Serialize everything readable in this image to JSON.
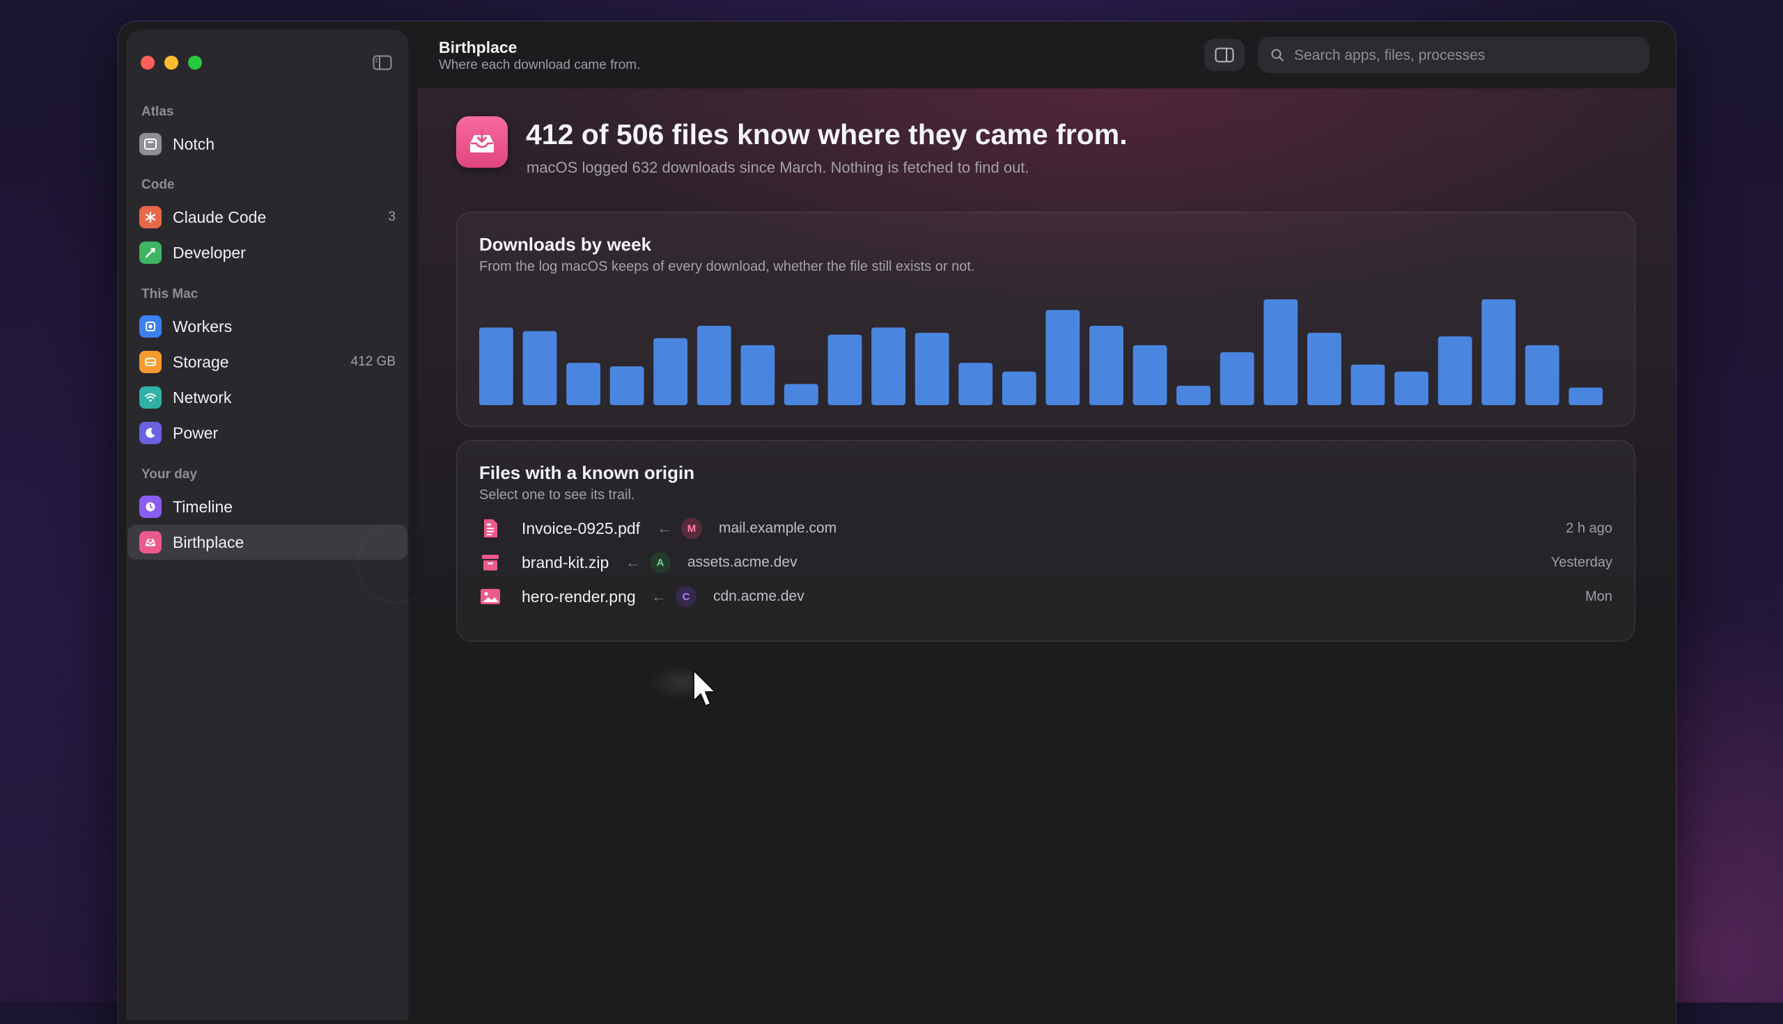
{
  "app": {
    "page_title": "Birthplace",
    "page_subtitle": "Where each download came from."
  },
  "search": {
    "placeholder": "Search apps, files, processes"
  },
  "sidebar": {
    "sections": [
      {
        "label": "Atlas",
        "items": [
          {
            "label": "Notch",
            "count": "",
            "icon": "notch-icon",
            "color": "#8e8e97"
          }
        ]
      },
      {
        "label": "Code",
        "items": [
          {
            "label": "Claude Code",
            "count": "3",
            "icon": "asterisk-icon",
            "color": "#e8684a"
          },
          {
            "label": "Developer",
            "count": "",
            "icon": "hammer-icon",
            "color": "#3fb463"
          }
        ]
      },
      {
        "label": "This Mac",
        "items": [
          {
            "label": "Workers",
            "count": "",
            "icon": "cpu-icon",
            "color": "#3b7ff0"
          },
          {
            "label": "Storage",
            "count": "412 GB",
            "icon": "drive-icon",
            "color": "#f59a2e"
          },
          {
            "label": "Network",
            "count": "",
            "icon": "wifi-icon",
            "color": "#2fb2a5"
          },
          {
            "label": "Power",
            "count": "",
            "icon": "moon-icon",
            "color": "#6a62e0"
          }
        ]
      },
      {
        "label": "Your day",
        "items": [
          {
            "label": "Timeline",
            "count": "",
            "icon": "clock-icon",
            "color": "#8b5cf0"
          },
          {
            "label": "Birthplace",
            "count": "",
            "icon": "inbox-icon",
            "color": "#ec5a8c",
            "active": true
          }
        ]
      }
    ]
  },
  "hero": {
    "title": "412 of 506 files know where they came from.",
    "subtitle": "macOS logged 632 downloads since March. Nothing is fetched to find out."
  },
  "downloads_card": {
    "title": "Downloads by week",
    "subtitle": "From the log macOS keeps of every download, whether the file still exists or not."
  },
  "chart_data": {
    "type": "bar",
    "title": "Downloads by week",
    "values": [
      22,
      21,
      12,
      11,
      19,
      22.5,
      17,
      6,
      20,
      22,
      20.5,
      12,
      9.5,
      27,
      22.5,
      17,
      5.5,
      15,
      30,
      20.5,
      11.5,
      9.5,
      19.5,
      30,
      17,
      5
    ],
    "color": "#4a86e0",
    "grid": false,
    "legend": "none"
  },
  "origins_card": {
    "title": "Files with a known origin",
    "subtitle": "Select one to see its trail.",
    "rows": [
      {
        "file": "Invoice-0925.pdf",
        "icon": "document-icon",
        "initial": "M",
        "domain": "mail.example.com",
        "avatar_color": "#5a2b3c",
        "avatar_text": "#ff7fa6",
        "time": "2 h ago"
      },
      {
        "file": "brand-kit.zip",
        "icon": "archive-icon",
        "initial": "A",
        "domain": "assets.acme.dev",
        "avatar_color": "#243a2c",
        "avatar_text": "#6fd08a",
        "time": "Yesterday"
      },
      {
        "file": "hero-render.png",
        "icon": "image-icon",
        "initial": "C",
        "domain": "cdn.acme.dev",
        "avatar_color": "#36284e",
        "avatar_text": "#a985f0",
        "time": "Mon"
      }
    ]
  }
}
